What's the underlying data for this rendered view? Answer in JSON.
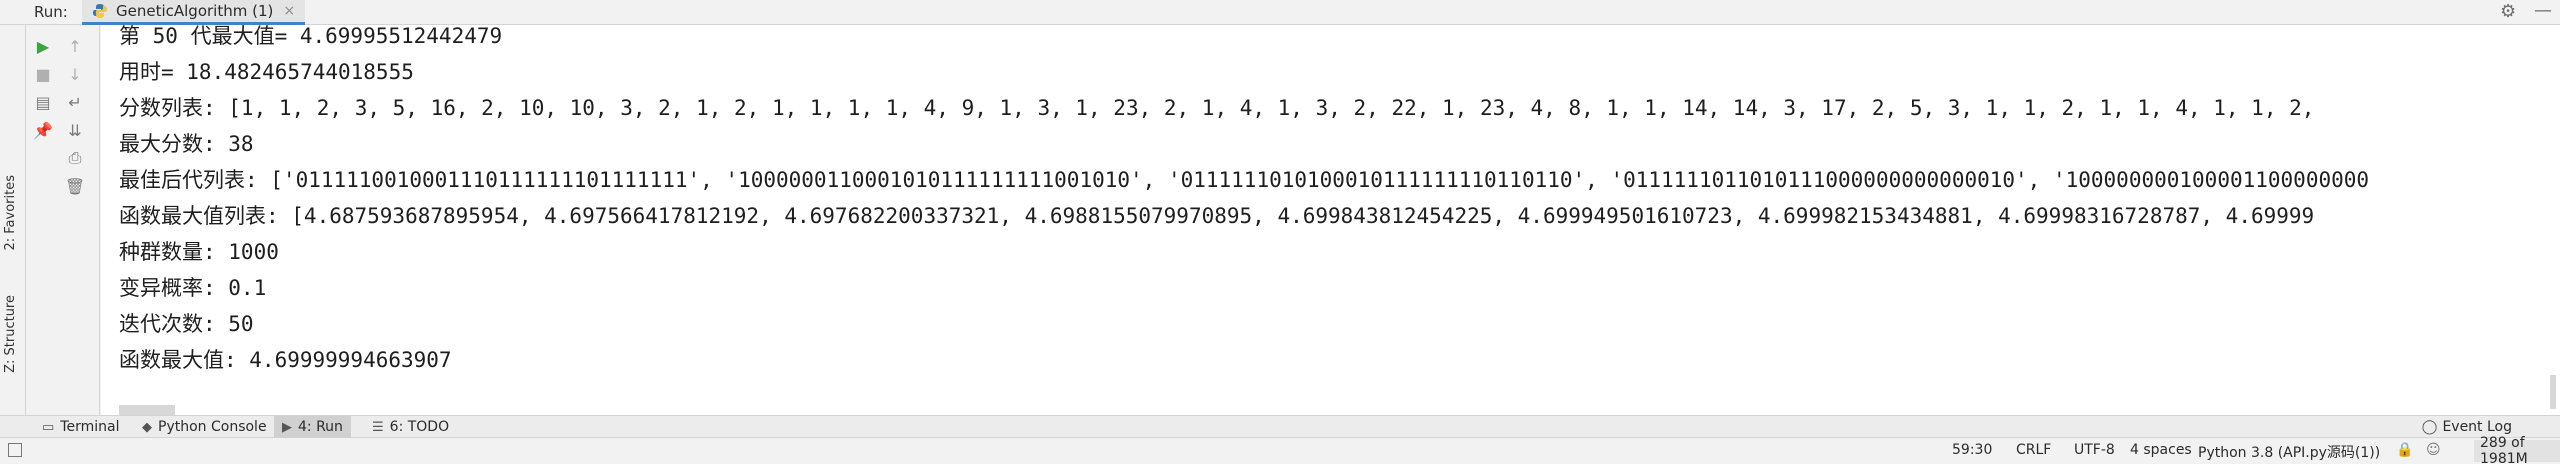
{
  "run_header": {
    "run_label": "Run:",
    "tab_title": "GeneticAlgorithm (1)",
    "close_glyph": "×",
    "settings_icon": "gear-icon",
    "minimize_icon": "minimize-icon"
  },
  "left_stripe": {
    "favorites_label": "2: Favorites",
    "structure_label": "Z: Structure"
  },
  "toolbar": {
    "rerun_icon": "play-icon",
    "stop_icon": "stop-icon",
    "layout_icon": "layout-icon",
    "pin_icon": "pin-icon",
    "up_icon": "arrow-up-icon",
    "down_icon": "arrow-down-icon",
    "soft_wrap_icon": "soft-wrap-icon",
    "scroll_end_icon": "scroll-to-end-icon",
    "print_icon": "print-icon",
    "clear_icon": "trash-icon"
  },
  "console": {
    "lines": [
      "第 50 代最大值= 4.69995512442479",
      "用时= 18.482465744018555",
      "分数列表: [1, 1, 2, 3, 5, 16, 2, 10, 10, 3, 2, 1, 2, 1, 1, 1, 1, 4, 9, 1, 3, 1, 23, 2, 1, 4, 1, 3, 2, 22, 1, 23, 4, 8, 1, 1, 14, 14, 3, 17, 2, 5, 3, 1, 1, 2, 1, 1, 4, 1, 1, 2,",
      "最大分数: 38",
      "最佳后代列表: ['0111110010001110111111101111111', '1000000110001010111111111001010', '0111111010100010111111110110110', '0111111011010111000000000000010', '100000000100001100000000",
      "函数最大值列表: [4.687593687895954, 4.697566417812192, 4.697682200337321, 4.6988155079970895, 4.699843812454225, 4.699949501610723, 4.699982153434881, 4.69998316728787, 4.69999",
      "种群数量: 1000",
      "变异概率: 0.1",
      "迭代次数: 50",
      "函数最大值: 4.69999994663907"
    ]
  },
  "bottom_tabs": [
    {
      "label": "Terminal",
      "icon": "terminal-icon"
    },
    {
      "label": "Python Console",
      "icon": "python-console-icon"
    },
    {
      "label": "4: Run",
      "icon": "run-icon"
    },
    {
      "label": "6: TODO",
      "icon": "todo-icon"
    }
  ],
  "event_log": {
    "label": "Event Log",
    "icon": "event-log-icon"
  },
  "status_bar": {
    "position": "59:30",
    "line_separator": "CRLF",
    "encoding": "UTF-8",
    "indent": "4 spaces",
    "interpreter": "Python 3.8 (API.py源码(1))",
    "lock_icon": "lock-icon",
    "memory": "289 of 1981M"
  }
}
